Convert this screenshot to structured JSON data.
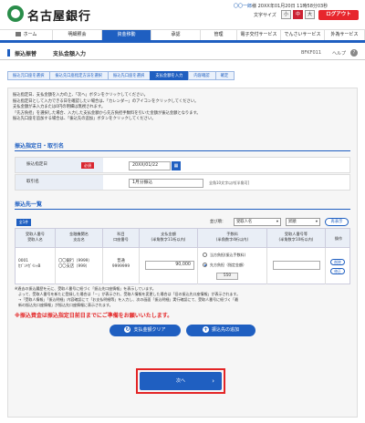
{
  "header": {
    "bank_name": "名古屋銀行",
    "user_name": "〇〇一郎",
    "user_suffix": "様",
    "last_login": "20XX年01月20日 11時58分03秒",
    "font_size_label": "文字サイズ",
    "font_sizes": [
      "小",
      "中",
      "大"
    ],
    "logout_label": "ログアウト"
  },
  "gnav": {
    "items": [
      {
        "label": "ホーム",
        "icon": "home-icon"
      },
      {
        "label": "明細照会",
        "icon": ""
      },
      {
        "label": "資金移動",
        "icon": "",
        "active": true
      },
      {
        "label": "承認",
        "icon": ""
      },
      {
        "label": "管理",
        "icon": ""
      },
      {
        "label": "電子交付サービス",
        "icon": ""
      },
      {
        "label": "でんさいサービス",
        "icon": ""
      },
      {
        "label": "外為サービス",
        "icon": ""
      }
    ]
  },
  "title": {
    "category": "振込振替",
    "page": "支払金額入力",
    "code": "BFKF011",
    "help": "ヘルプ"
  },
  "steps": [
    "振込元口座を選択",
    "振込先口座指定方法を選択",
    "振込先口座を選択",
    "支払金額を入力",
    "内容確認",
    "確定"
  ],
  "instructions": [
    "振込指定日、支払金額を入力の上、「次へ」ボタンをクリックしてください。",
    "振込指定日として入力できる日を確認したい場合は、「カレンダー」のアイコンをクリックしてください。",
    "支払金額が未入力または0円の明細は無視されます。",
    "「先方負担」を選択した場合、入力した支払金額から先方負担手数料を引いた金額が振込金額となります。",
    "振込先口座を追加する場合は、「振込先の追加」ボタンをクリックしてください。"
  ],
  "section1": {
    "title": "振込指定日・取引名",
    "date_label": "振込指定日",
    "required": "必須",
    "date_value": "20XX/01/22",
    "txn_label": "取引名",
    "txn_value": "1月分振込",
    "txn_hint": "全角10文字以内[半角可]"
  },
  "section2": {
    "title": "振込先一覧",
    "all_label": "全1件",
    "sort_label": "並び順：",
    "sort_key": "受取人名",
    "sort_order": "昇順",
    "sort_button": "再表示",
    "columns": [
      "受取人番号\n受取人名",
      "金融機関名\n支店名",
      "科目\n口座番号",
      "支払金額\n(半角数字11桁以内)",
      "手数料\n(半角数字4桁以内)",
      "受取人番号等\n(半角数字10桁以内)",
      "操作"
    ],
    "row": {
      "recipient_no": "0001",
      "recipient_name": "ｶﾌﾞｼｷｶﾞｲｼｬB",
      "bank": "〇〇銀行（9999）",
      "branch": "〇〇支店（999）",
      "account_type": "普通",
      "account_no": "9999999",
      "amount": "90,000",
      "fee_option1": "当方負担(振込手数料)",
      "fee_option2": "先方負担（指定金額）",
      "fee_value": "550",
      "op1": "削除",
      "op2": "修正"
    }
  },
  "notes": [
    "※過去の振込履歴を元に、受取人番号に紐づく「振込先口座情報」を表示しています。",
    "　よって、受取人番号を新たに登録した場合は「－」が表示され、受取人情報を変更した場合は「旧の振込先口座情報」が表示されます。",
    "　→「受取人情報」「振込明細」内容確認にて「お支払明細等」を入力し、次の画面「振込明細」実行確認にて、受取人番号に紐づく「最",
    "　新の振込先口座情報」が振込先口座情報に表示されます。"
  ],
  "warning": "※振込資金は振込指定日前日までにご準備をお願いいたします。",
  "buttons": {
    "clear": "支払金額クリア",
    "add": "振込先の追加",
    "next": "次へ"
  }
}
